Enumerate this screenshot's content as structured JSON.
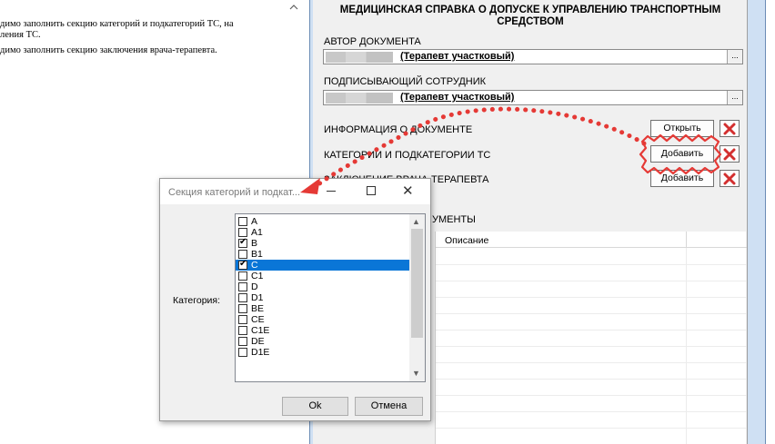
{
  "left_doc": {
    "line1": "димо заполнить секцию категорий и подкатегорий ТС, на",
    "line2": "ления ТС.",
    "line3": "димо заполнить секцию заключения врача-терапевта."
  },
  "form": {
    "title_line1": "МЕДИЦИНСКАЯ СПРАВКА О ДОПУСКЕ К УПРАВЛЕНИЮ ТРАНСПОРТНЫМ",
    "title_line2": "СРЕДСТВОМ",
    "author_label": "АВТОР ДОКУМЕНТА",
    "author_value": "(Терапевт участковый)",
    "signer_label": "ПОДПИСЫВАЮЩИЙ СОТРУДНИК",
    "signer_value": "(Терапевт участковый)",
    "browse_label": "...",
    "sections": [
      {
        "label": "ИНФОРМАЦИЯ О ДОКУМЕНТЕ",
        "button": "Открыть"
      },
      {
        "label": "КАТЕГОРИИ И ПОДКАТЕГОРИИ ТС",
        "button": "Добавить"
      },
      {
        "label": "ЗАКЛЮЧЕНИЕ ВРАЧА-ТЕРАПЕВТА",
        "button": "Добавить"
      }
    ],
    "documents_label": "УМЕНТЫ",
    "table_header_desc": "Описание"
  },
  "dialog": {
    "title": "Секция категорий и подкат...",
    "category_label": "Категория:",
    "items": [
      {
        "label": "A",
        "checked": false,
        "selected": false
      },
      {
        "label": "A1",
        "checked": false,
        "selected": false
      },
      {
        "label": "B",
        "checked": true,
        "selected": false
      },
      {
        "label": "B1",
        "checked": false,
        "selected": false
      },
      {
        "label": "C",
        "checked": true,
        "selected": true
      },
      {
        "label": "C1",
        "checked": false,
        "selected": false
      },
      {
        "label": "D",
        "checked": false,
        "selected": false
      },
      {
        "label": "D1",
        "checked": false,
        "selected": false
      },
      {
        "label": "BE",
        "checked": false,
        "selected": false
      },
      {
        "label": "CE",
        "checked": false,
        "selected": false
      },
      {
        "label": "C1E",
        "checked": false,
        "selected": false
      },
      {
        "label": "DE",
        "checked": false,
        "selected": false
      },
      {
        "label": "D1E",
        "checked": false,
        "selected": false
      }
    ],
    "ok_label": "Ok",
    "cancel_label": "Отмена"
  },
  "colors": {
    "annotation": "#e53935",
    "selection": "#0a76d7",
    "delete_icon": "#d32f2f"
  },
  "icons": {
    "delete": "delete-x-icon",
    "scroll_up": "chevron-up-icon",
    "scroll_down": "chevron-down-icon",
    "close": "close-icon"
  }
}
